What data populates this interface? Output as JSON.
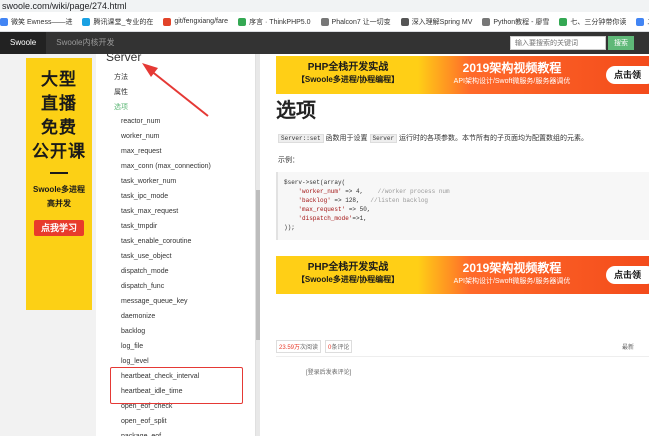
{
  "browser": {
    "url": "swoole.com/wiki/page/274.html"
  },
  "bookmarks": [
    {
      "label": "微笑 Ewness——进",
      "color": "#4285f4"
    },
    {
      "label": "腾讯课堂_专业的在",
      "color": "#1aa1e3"
    },
    {
      "label": "git/fengxiang/fare",
      "color": "#e24329"
    },
    {
      "label": "序言 · ThinkPHP5.0",
      "color": "#34a853"
    },
    {
      "label": "Phalcon7 让一切变",
      "color": "#777777"
    },
    {
      "label": "深入理解Spring MV",
      "color": "#555555"
    },
    {
      "label": "Python教程 - 廖雪",
      "color": "#777777"
    },
    {
      "label": "七、三分钟带你读",
      "color": "#34a853"
    },
    {
      "label": "二、Layer",
      "color": "#4285f4"
    }
  ],
  "nav": {
    "items": [
      "Swoole",
      "Swoole内核开发"
    ],
    "search_placeholder": "输入要搜索的关键词",
    "search_button": "搜索"
  },
  "left_ad": {
    "big_lines": [
      "大型",
      "直播",
      "免费",
      "公开课"
    ],
    "line1": "Swoole多进程",
    "line2": "高并发",
    "button": "点我学习"
  },
  "sidebar": {
    "title": "Server",
    "sections": [
      "方法",
      "属性",
      "选项"
    ],
    "options": [
      "reactor_num",
      "worker_num",
      "max_request",
      "max_conn (max_connection)",
      "task_worker_num",
      "task_ipc_mode",
      "task_max_request",
      "task_tmpdir",
      "task_enable_coroutine",
      "task_use_object",
      "dispatch_mode",
      "dispatch_func",
      "message_queue_key",
      "daemonize",
      "backlog",
      "log_file",
      "log_level",
      "heartbeat_check_interval",
      "heartbeat_idle_time",
      "open_eof_check",
      "open_eof_split",
      "package_eof"
    ]
  },
  "banner": {
    "left_line1": "PHP全栈开发实战",
    "left_line2": "【Swoole多进程/协程编程】",
    "right_line1": "2019架构视频教程",
    "right_line2": "API架构设计/Swoft微服务/服务器调优",
    "button": "点击领"
  },
  "content": {
    "title": "选项",
    "desc_code1": "Server::set",
    "desc_mid": " 函数用于设置 ",
    "desc_code2": "Server",
    "desc_end": " 运行时的各项参数。本节所有的子页面均为配置数组的元素。",
    "example_label": "示例：",
    "code": {
      "l1": "$serv->set(array(",
      "l2_key": "    'worker_num'",
      "l2_val": " => 4,    ",
      "l2_cmt": "//worker process num",
      "l3_key": "    'backlog'",
      "l3_val": " => 128,   ",
      "l3_cmt": "//listen backlog",
      "l4_key": "    'max_request'",
      "l4_val": " => 50,",
      "l5_key": "    'dispatch_mode'",
      "l5_val": "=>1,",
      "l6": "));"
    }
  },
  "stats": {
    "views_num": "23.59万",
    "views_label": "次阅读",
    "comments_num": "0",
    "comments_label": "条评论",
    "right": "最新"
  },
  "login_comment": "[登录后发表评论]"
}
